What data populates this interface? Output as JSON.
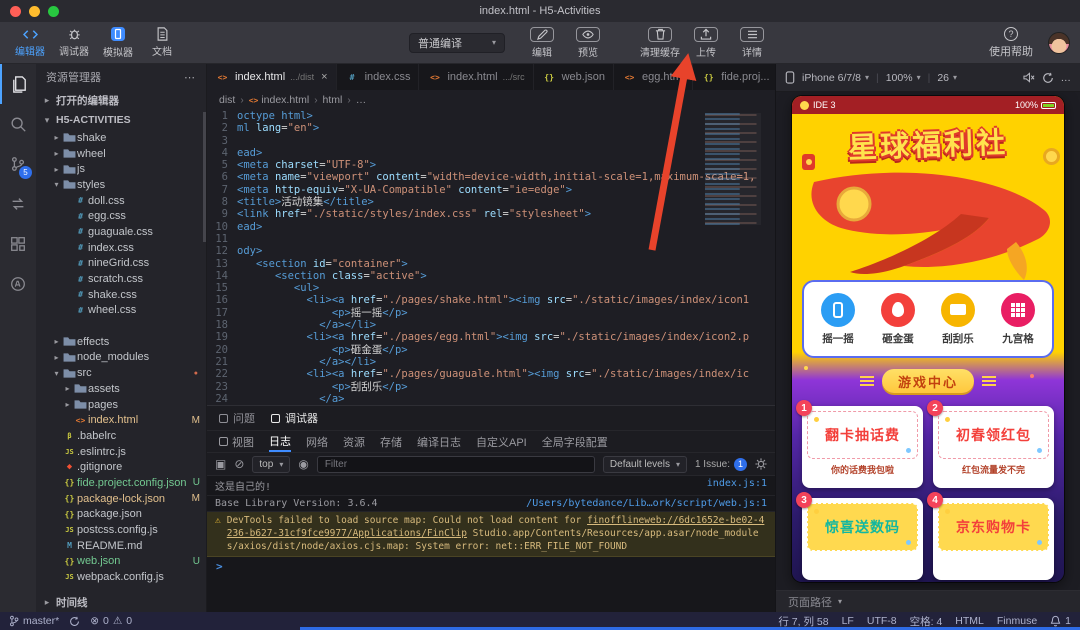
{
  "titlebar": {
    "title": "index.html - H5-Activities"
  },
  "toolbar": {
    "nav": [
      {
        "label": "编辑器",
        "icon": "code-icon",
        "active": true
      },
      {
        "label": "调试器",
        "icon": "bug-icon",
        "active": false
      },
      {
        "label": "模拟器",
        "icon": "simulator-icon",
        "active": false
      },
      {
        "label": "文档",
        "icon": "doc-icon",
        "active": false
      }
    ],
    "compile_select": "普通编译",
    "actions": [
      {
        "label": "编辑",
        "icon": "edit-icon"
      },
      {
        "label": "预览",
        "icon": "preview-icon"
      }
    ],
    "tools": [
      {
        "label": "清理缓存",
        "icon": "clean-icon"
      },
      {
        "label": "上传",
        "icon": "upload-icon"
      },
      {
        "label": "详情",
        "icon": "detail-icon"
      }
    ],
    "help": {
      "label": "使用帮助"
    }
  },
  "sidebar": {
    "title": "资源管理器",
    "open_editors": "打开的编辑器",
    "root": "H5-ACTIVITIES",
    "timeline": "时间线",
    "files": [
      {
        "name": "shake",
        "kind": "folder",
        "level": 1
      },
      {
        "name": "wheel",
        "kind": "folder",
        "level": 1
      },
      {
        "name": "js",
        "kind": "folder",
        "level": 1
      },
      {
        "name": "styles",
        "kind": "folder-open",
        "level": 1
      },
      {
        "name": "doll.css",
        "kind": "css",
        "level": 2
      },
      {
        "name": "egg.css",
        "kind": "css",
        "level": 2
      },
      {
        "name": "guaguale.css",
        "kind": "css",
        "level": 2
      },
      {
        "name": "index.css",
        "kind": "css",
        "level": 2
      },
      {
        "name": "nineGrid.css",
        "kind": "css",
        "level": 2
      },
      {
        "name": "scratch.css",
        "kind": "css",
        "level": 2
      },
      {
        "name": "shake.css",
        "kind": "css",
        "level": 2
      },
      {
        "name": "wheel.css",
        "kind": "css",
        "level": 2
      },
      {
        "name": "index.html",
        "kind": "html",
        "level": 1,
        "selected": true
      },
      {
        "name": "effects",
        "kind": "folder",
        "level": 1
      },
      {
        "name": "node_modules",
        "kind": "folder",
        "level": 1
      },
      {
        "name": "src",
        "kind": "folder-open",
        "level": 1,
        "dot": true
      },
      {
        "name": "assets",
        "kind": "folder",
        "level": 2
      },
      {
        "name": "pages",
        "kind": "folder",
        "level": 2
      },
      {
        "name": "index.html",
        "kind": "html",
        "level": 2,
        "badge": "M"
      },
      {
        "name": ".babelrc",
        "kind": "config",
        "level": 1
      },
      {
        "name": ".eslintrc.js",
        "kind": "js",
        "level": 1
      },
      {
        "name": ".gitignore",
        "kind": "git",
        "level": 1
      },
      {
        "name": "fide.project.config.json",
        "kind": "json",
        "level": 1,
        "badge": "U"
      },
      {
        "name": "package-lock.json",
        "kind": "json",
        "level": 1,
        "badge": "M"
      },
      {
        "name": "package.json",
        "kind": "json",
        "level": 1
      },
      {
        "name": "postcss.config.js",
        "kind": "js",
        "level": 1
      },
      {
        "name": "README.md",
        "kind": "md",
        "level": 1
      },
      {
        "name": "web.json",
        "kind": "json",
        "level": 1,
        "badge": "U"
      },
      {
        "name": "webpack.config.js",
        "kind": "js",
        "level": 1
      }
    ]
  },
  "editor": {
    "tabs": [
      {
        "name": "index.html",
        "hint": ".../dist",
        "kind": "html",
        "active": true
      },
      {
        "name": "index.css",
        "kind": "css"
      },
      {
        "name": "index.html",
        "hint": ".../src",
        "kind": "html"
      },
      {
        "name": "web.json",
        "kind": "json"
      },
      {
        "name": "egg.html",
        "kind": "html"
      },
      {
        "name": "fide.proj...",
        "kind": "json"
      }
    ],
    "breadcrumb": [
      "dist",
      "index.html",
      "html",
      "…"
    ],
    "code": [
      [
        [
          "g",
          "octype html>"
        ]
      ],
      [
        [
          "g",
          "ml "
        ],
        [
          "a",
          "lang"
        ],
        [
          "t",
          "="
        ],
        [
          "s",
          "\"en\""
        ],
        [
          "g",
          ">"
        ]
      ],
      [],
      [
        [
          "g",
          "ead>"
        ]
      ],
      [
        [
          "g",
          "<meta "
        ],
        [
          "a",
          "charset"
        ],
        [
          "t",
          "="
        ],
        [
          "s",
          "\"UTF-8\""
        ],
        [
          "g",
          ">"
        ]
      ],
      [
        [
          "g",
          "<meta "
        ],
        [
          "a",
          "name"
        ],
        [
          "t",
          "="
        ],
        [
          "s",
          "\"viewport\""
        ],
        [
          "a",
          " content"
        ],
        [
          "t",
          "="
        ],
        [
          "s",
          "\"width=device-width,initial-scale=1,maximum-scale=1,"
        ]
      ],
      [
        [
          "g",
          "<meta "
        ],
        [
          "a",
          "http-equiv"
        ],
        [
          "t",
          "="
        ],
        [
          "s",
          "\"X-UA-Compatible\""
        ],
        [
          "a",
          " content"
        ],
        [
          "t",
          "="
        ],
        [
          "s",
          "\"ie=edge\""
        ],
        [
          "g",
          ">"
        ]
      ],
      [
        [
          "g",
          "<title>"
        ],
        [
          "t",
          "活动镜集"
        ],
        [
          "g",
          "</title>"
        ]
      ],
      [
        [
          "g",
          "<link "
        ],
        [
          "a",
          "href"
        ],
        [
          "t",
          "="
        ],
        [
          "s",
          "\"./static/styles/index.css\""
        ],
        [
          "a",
          " rel"
        ],
        [
          "t",
          "="
        ],
        [
          "s",
          "\"stylesheet\""
        ],
        [
          "g",
          ">"
        ]
      ],
      [
        [
          "g",
          "ead>"
        ]
      ],
      [],
      [
        [
          "g",
          "ody>"
        ]
      ],
      [
        [
          "t",
          "   "
        ],
        [
          "g",
          "<section "
        ],
        [
          "a",
          "id"
        ],
        [
          "t",
          "="
        ],
        [
          "s",
          "\"container\""
        ],
        [
          "g",
          ">"
        ]
      ],
      [
        [
          "t",
          "      "
        ],
        [
          "g",
          "<section "
        ],
        [
          "a",
          "class"
        ],
        [
          "t",
          "="
        ],
        [
          "s",
          "\"active\""
        ],
        [
          "g",
          ">"
        ]
      ],
      [
        [
          "t",
          "         "
        ],
        [
          "g",
          "<ul>"
        ]
      ],
      [
        [
          "t",
          "           "
        ],
        [
          "g",
          "<li><a "
        ],
        [
          "a",
          "href"
        ],
        [
          "t",
          "="
        ],
        [
          "s",
          "\"./pages/shake.html\""
        ],
        [
          "g",
          "><img "
        ],
        [
          "a",
          "src"
        ],
        [
          "t",
          "="
        ],
        [
          "s",
          "\"./static/images/index/icon1"
        ]
      ],
      [
        [
          "t",
          "               "
        ],
        [
          "g",
          "<p>"
        ],
        [
          "t",
          "摇一摇"
        ],
        [
          "g",
          "</p>"
        ]
      ],
      [
        [
          "t",
          "             "
        ],
        [
          "g",
          "</a></li>"
        ]
      ],
      [
        [
          "t",
          "           "
        ],
        [
          "g",
          "<li><a "
        ],
        [
          "a",
          "href"
        ],
        [
          "t",
          "="
        ],
        [
          "s",
          "\"./pages/egg.html\""
        ],
        [
          "g",
          "><img "
        ],
        [
          "a",
          "src"
        ],
        [
          "t",
          "="
        ],
        [
          "s",
          "\"./static/images/index/icon2.p"
        ]
      ],
      [
        [
          "t",
          "               "
        ],
        [
          "g",
          "<p>"
        ],
        [
          "t",
          "砸金蛋"
        ],
        [
          "g",
          "</p>"
        ]
      ],
      [
        [
          "t",
          "             "
        ],
        [
          "g",
          "</a></li>"
        ]
      ],
      [
        [
          "t",
          "           "
        ],
        [
          "g",
          "<li><a "
        ],
        [
          "a",
          "href"
        ],
        [
          "t",
          "="
        ],
        [
          "s",
          "\"./pages/guaguale.html\""
        ],
        [
          "g",
          "><img "
        ],
        [
          "a",
          "src"
        ],
        [
          "t",
          "="
        ],
        [
          "s",
          "\"./static/images/index/ic"
        ]
      ],
      [
        [
          "t",
          "               "
        ],
        [
          "g",
          "<p>"
        ],
        [
          "t",
          "刮刮乐"
        ],
        [
          "g",
          "</p>"
        ]
      ],
      [
        [
          "t",
          "             "
        ],
        [
          "g",
          "</a>"
        ]
      ]
    ]
  },
  "panel": {
    "tabs": [
      {
        "label": "问题"
      },
      {
        "label": "调试器",
        "active": true
      }
    ],
    "subtabs": [
      {
        "label": "视图",
        "icon": true
      },
      {
        "label": "日志",
        "active": true
      },
      {
        "label": "网络"
      },
      {
        "label": "资源"
      },
      {
        "label": "存储"
      },
      {
        "label": "编译日志"
      },
      {
        "label": "自定义API"
      },
      {
        "label": "全局字段配置"
      }
    ],
    "console": {
      "frame_select": "top",
      "filter_placeholder": "Filter",
      "levels_select": "Default levels",
      "issues_label": "1 Issue:",
      "issues_count": "1",
      "logs": [
        {
          "text": "这是自己的!",
          "source": "index.js:1"
        },
        {
          "text": "Base Library Version: 3.6.4",
          "source": "/Users/bytedance/Lib…ork/script/web.js:1"
        }
      ],
      "warning": {
        "text": "DevTools failed to load source map: Could not load content for ",
        "link1": "finofflineweb://6dc1652e-be02-4236-b627-31cf9fce9977/Applications/FinClip",
        "mid": " Studio.app/Contents/Resources/app.asar/node_modules/axios/dist/node/axios.cjs.map: System error: net::ERR_FILE_NOT_FOUND"
      },
      "prompt": ">"
    }
  },
  "simulator": {
    "device": "iPhone 6/7/8",
    "zoom": "100%",
    "fps": "26",
    "footer": "页面路径",
    "phone": {
      "statusbar_left": "IDE 3",
      "battery": "100%",
      "title": "星球福利社",
      "menu": [
        {
          "label": "摇一摇",
          "color": "#2b9df4"
        },
        {
          "label": "砸金蛋",
          "color": "#f3403b"
        },
        {
          "label": "刮刮乐",
          "color": "#f7b500"
        },
        {
          "label": "九宫格",
          "color": "#e91e63"
        }
      ],
      "game_center": "游戏中心",
      "coupons": [
        {
          "num": "1",
          "title": "翻卡抽话费",
          "subtitle": "你的话费我包啦",
          "title_color": "#f3403b"
        },
        {
          "num": "2",
          "title": "初春领红包",
          "subtitle": "红包流量发不完",
          "title_color": "#f3403b"
        },
        {
          "num": "3",
          "title": "惊喜送数码",
          "subtitle": "",
          "title_color": "#12b7a0"
        },
        {
          "num": "4",
          "title": "京东购物卡",
          "subtitle": "",
          "title_color": "#f3403b"
        }
      ]
    }
  },
  "statusbar": {
    "branch": "master*",
    "errors": "0",
    "warnings": "0",
    "line_col": "行 7, 列 58",
    "eol": "LF",
    "encoding": "UTF-8",
    "spaces": "空格: 4",
    "lang": "HTML",
    "linter": "Finmuse",
    "bell_count": "1"
  }
}
